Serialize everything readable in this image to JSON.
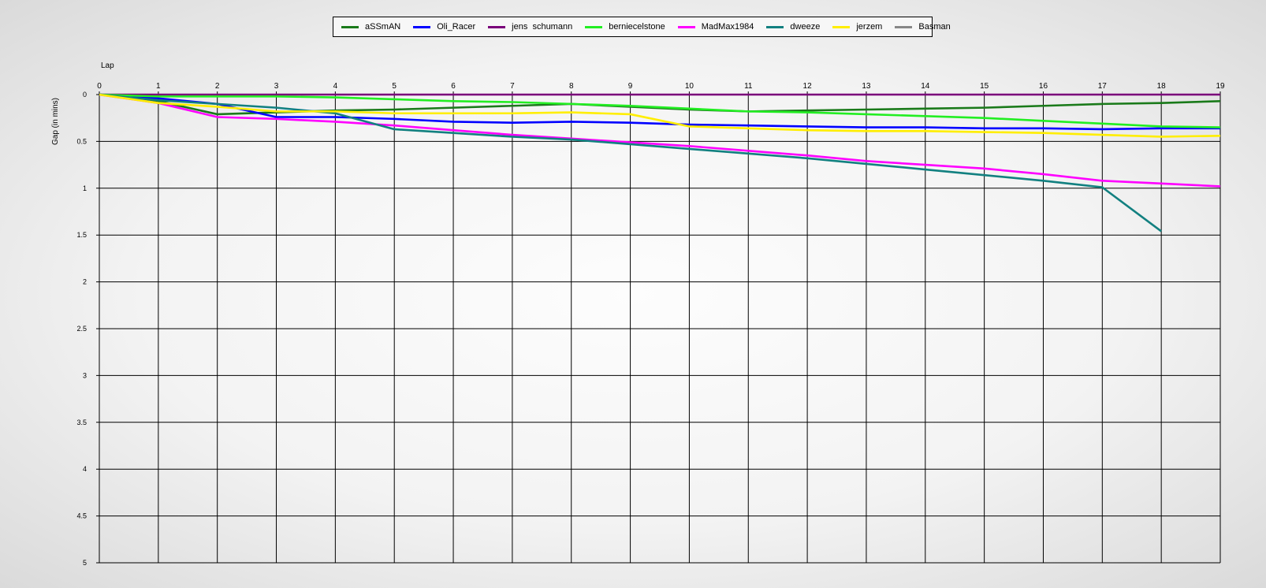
{
  "chart_data": {
    "type": "line",
    "xlabel": "Lap",
    "ylabel": "Gap (in mins)",
    "x_ticks": [
      "0",
      "1",
      "2",
      "3",
      "4",
      "5",
      "6",
      "7",
      "8",
      "9",
      "10",
      "11",
      "12",
      "13",
      "14",
      "15",
      "16",
      "17",
      "18",
      "19"
    ],
    "y_ticks": [
      "0",
      "0.5",
      "1",
      "1.5",
      "2",
      "2.5",
      "3",
      "3.5",
      "4",
      "4.5",
      "5"
    ],
    "xlim": [
      0,
      19
    ],
    "ylim": [
      0,
      5
    ],
    "y_inverted": true,
    "grid": true,
    "legend_position": "top-center",
    "series": [
      {
        "name": "aSSmAN",
        "color": "#1a7a1a",
        "x": [
          0,
          1,
          2,
          3,
          4,
          5,
          6,
          7,
          8,
          9,
          10,
          11,
          12,
          13,
          14,
          15,
          16,
          17,
          18,
          19
        ],
        "values": [
          0,
          0.07,
          0.21,
          0.19,
          0.17,
          0.16,
          0.14,
          0.12,
          0.1,
          0.13,
          0.16,
          0.18,
          0.17,
          0.16,
          0.15,
          0.14,
          0.12,
          0.1,
          0.09,
          0.07
        ]
      },
      {
        "name": "Oli_Racer",
        "color": "#0000ff",
        "x": [
          0,
          1,
          2,
          3,
          4,
          5,
          6,
          7,
          8,
          9,
          10,
          11,
          12,
          13,
          14,
          15,
          16,
          17,
          18,
          19
        ],
        "values": [
          0,
          0.04,
          0.1,
          0.24,
          0.24,
          0.26,
          0.29,
          0.3,
          0.29,
          0.3,
          0.32,
          0.33,
          0.34,
          0.35,
          0.35,
          0.36,
          0.36,
          0.37,
          0.36,
          0.36
        ]
      },
      {
        "name": "jens  schumann",
        "color": "#7a007a",
        "x": [
          0,
          1,
          2,
          3,
          4,
          5,
          6,
          7,
          8,
          9,
          10,
          11,
          12,
          13,
          14,
          15,
          16,
          17,
          18,
          19
        ],
        "values": [
          0,
          0,
          0,
          0,
          0,
          0,
          0,
          0,
          0,
          0,
          0,
          0,
          0,
          0,
          0,
          0,
          0,
          0,
          0,
          0
        ]
      },
      {
        "name": "berniecelstone",
        "color": "#22ee22",
        "x": [
          0,
          1,
          2,
          3,
          4,
          5,
          6,
          7,
          8,
          9,
          10,
          11,
          12,
          13,
          14,
          15,
          16,
          17,
          18,
          19
        ],
        "values": [
          0,
          0.02,
          0.02,
          0.02,
          0.03,
          0.05,
          0.07,
          0.08,
          0.1,
          0.12,
          0.15,
          0.18,
          0.19,
          0.21,
          0.23,
          0.25,
          0.28,
          0.31,
          0.34,
          0.35
        ]
      },
      {
        "name": "MadMax1984",
        "color": "#ff00ff",
        "x": [
          0,
          1,
          2,
          3,
          4,
          5,
          6,
          7,
          8,
          9,
          10,
          11,
          12,
          13,
          14,
          15,
          16,
          17,
          18,
          19
        ],
        "values": [
          0,
          0.09,
          0.24,
          0.26,
          0.29,
          0.33,
          0.38,
          0.43,
          0.47,
          0.51,
          0.55,
          0.6,
          0.65,
          0.71,
          0.75,
          0.79,
          0.85,
          0.92,
          0.95,
          0.98
        ]
      },
      {
        "name": "dweeze",
        "color": "#128080",
        "x": [
          0,
          1,
          2,
          3,
          4,
          5,
          6,
          7,
          8,
          9,
          10,
          11,
          12,
          13,
          14,
          15,
          16,
          17,
          18
        ],
        "values": [
          0,
          0.06,
          0.1,
          0.14,
          0.2,
          0.37,
          0.41,
          0.45,
          0.48,
          0.53,
          0.58,
          0.63,
          0.68,
          0.74,
          0.8,
          0.86,
          0.92,
          0.99,
          1.46
        ]
      },
      {
        "name": "jerzem",
        "color": "#ffee00",
        "x": [
          0,
          1,
          2,
          3,
          4,
          5,
          6,
          7,
          8,
          9,
          10,
          11,
          12,
          13,
          14,
          15,
          16,
          17,
          18,
          19
        ],
        "values": [
          0,
          0.09,
          0.13,
          0.18,
          0.18,
          0.2,
          0.2,
          0.2,
          0.19,
          0.21,
          0.34,
          0.36,
          0.38,
          0.39,
          0.39,
          0.4,
          0.41,
          0.43,
          0.45,
          0.44
        ]
      },
      {
        "name": "Basman",
        "color": "#888888",
        "x": [],
        "values": []
      }
    ]
  }
}
